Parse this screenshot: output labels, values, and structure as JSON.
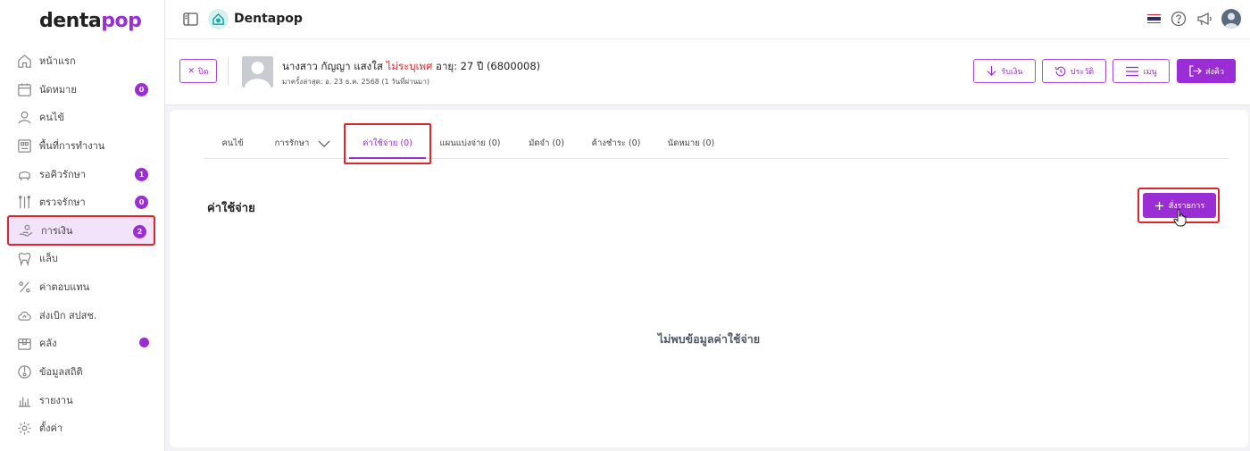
{
  "app": {
    "logo_text_1": "denta",
    "logo_text_2": "pop",
    "clinic_name": "Dentapop"
  },
  "sidebar": {
    "items": [
      {
        "label": "หน้าแรก",
        "icon": "home-icon"
      },
      {
        "label": "นัดหมาย",
        "icon": "calendar-icon",
        "badge": "0"
      },
      {
        "label": "คนไข้",
        "icon": "user-icon"
      },
      {
        "label": "พื้นที่การทำงาน",
        "icon": "workspace-icon"
      },
      {
        "label": "รอคิวรักษา",
        "icon": "dental-chair-icon",
        "badge": "1"
      },
      {
        "label": "ตรวจรักษา",
        "icon": "dental-tools-icon",
        "badge": "0"
      },
      {
        "label": "การเงิน",
        "icon": "money-hand-icon",
        "badge": "2",
        "active": true
      },
      {
        "label": "แล็บ",
        "icon": "tooth-icon"
      },
      {
        "label": "ค่าตอบแทน",
        "icon": "percent-icon"
      },
      {
        "label": "ส่งเบิก สปสช.",
        "icon": "cloud-upload-icon"
      },
      {
        "label": "คลัง",
        "icon": "box-icon",
        "dot": true
      },
      {
        "label": "ข้อมูลสถิติ",
        "icon": "stats-icon"
      },
      {
        "label": "รายงาน",
        "icon": "report-chart-icon"
      },
      {
        "label": "ตั้งค่า",
        "icon": "gear-icon"
      }
    ]
  },
  "patient": {
    "close_label": "ปิด",
    "title": "นางสาว กัญญา แสงใส",
    "gender": "ไม่ระบุเพศ",
    "age": "อายุ: 27 ปี",
    "hn": "(6800008)",
    "last_visit": "มาครั้งล่าสุด: อ. 23 ธ.ค. 2568 (1 วันที่ผ่านมา)"
  },
  "header_actions": {
    "receive_label": "รับเงิน",
    "history_label": "ประวัติ",
    "menu_label": "เมนู",
    "send_queue_label": "ส่งคิว"
  },
  "tabs": [
    {
      "label": "คนไข้"
    },
    {
      "label": "การรักษา"
    },
    {
      "label": "ค่าใช้จ่าย (0)",
      "active": true
    },
    {
      "label": "แผนแบ่งจ่าย (0)"
    },
    {
      "label": "มัดจำ (0)"
    },
    {
      "label": "ค้างชำระ (0)"
    },
    {
      "label": "นัดหมาย (0)"
    }
  ],
  "main": {
    "section_title": "ค่าใช้จ่าย",
    "add_button_label": "สั่งรายการ",
    "empty_text": "ไม่พบข้อมูลค่าใช้จ่าย"
  },
  "colors": {
    "accent": "#9b2dd6",
    "highlight": "#e0242b",
    "active_bg": "#f2e3fa"
  }
}
